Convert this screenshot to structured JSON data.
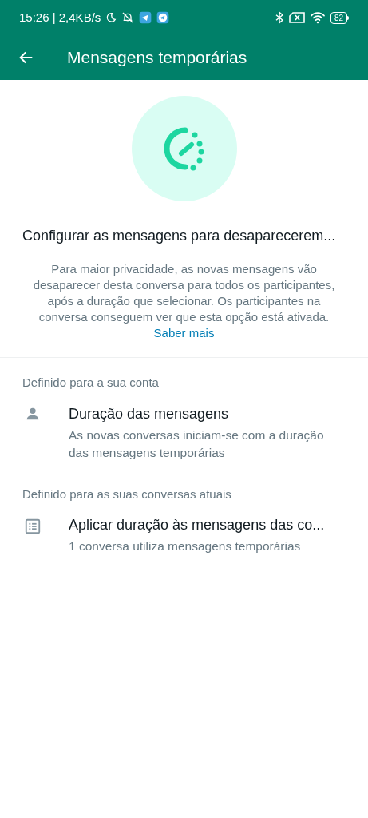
{
  "status_bar": {
    "time": "15:26 | 2,4KB/s",
    "battery": "82"
  },
  "app_bar": {
    "title": "Mensagens temporárias"
  },
  "header": {
    "heading": "Configurar as mensagens para desaparecerem...",
    "description": "Para maior privacidade, as novas mensagens vão desaparecer desta conversa para todos os participantes, após a duração que selecionar. Os participantes na conversa conseguem ver que esta opção está ativada.",
    "link": "Saber mais"
  },
  "sections": [
    {
      "title": "Definido para a sua conta",
      "items": [
        {
          "kind": "person",
          "title": "Duração das mensagens",
          "subtitle": "As novas conversas iniciam-se com a duração das mensagens temporárias"
        }
      ]
    },
    {
      "title": "Definido para as suas conversas atuais",
      "items": [
        {
          "kind": "list",
          "title": "Aplicar duração às mensagens das co...",
          "subtitle": "1 conversa utiliza mensagens temporárias"
        }
      ]
    }
  ]
}
